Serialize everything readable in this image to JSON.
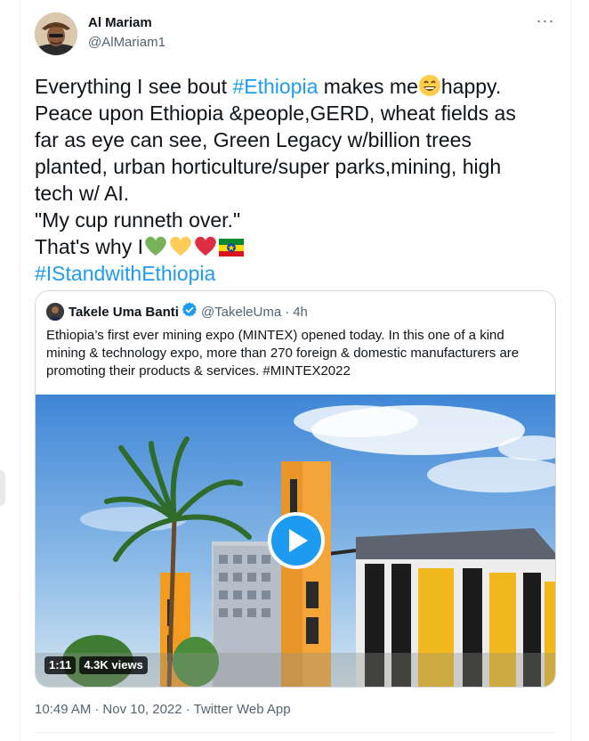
{
  "author": {
    "display_name": "Al Mariam",
    "handle": "@AlMariam1",
    "avatar_icon": "user-avatar"
  },
  "more_icon": "more-horizontal-icon",
  "tweet": {
    "line1_pre": "Everything I see bout ",
    "line1_hashtag": "#Ethiopia",
    "line1_mid": " makes me",
    "line1_emoji": "grinning-face-emoji",
    "line1_post": "happy.",
    "line2": "Peace upon Ethiopia &people,GERD, wheat fields as",
    "line3": "far as eye can see, Green Legacy w/billion trees",
    "line4": "planted, urban horticulture/super parks,mining, high",
    "line5": "tech w/ AI.",
    "line6": "\"My cup runneth over.\"",
    "line7": "That's why I",
    "line7_emojis": [
      "green-heart-emoji",
      "yellow-heart-emoji",
      "red-heart-emoji",
      "ethiopia-flag-emoji"
    ],
    "line8_hashtag": " #IStandwithEthiopia"
  },
  "quoted": {
    "display_name": "Takele Uma Banti",
    "verified_icon": "verified-badge-icon",
    "handle": "@TakeleUma",
    "dot": "·",
    "time": "4h",
    "text_line1": "Ethiopia’s first ever mining expo (MINTEX) opened today. In this one of a kind",
    "text_line2": "mining & technology expo, more than 270 foreign & domestic manufacturers are",
    "text_line3": "promoting their products & services. #MINTEX2022",
    "video": {
      "duration": "1:11",
      "views": "4.3K views",
      "play_icon": "play-icon"
    }
  },
  "meta": {
    "time": "10:49 AM",
    "sep1": "·",
    "date": "Nov 10, 2022",
    "sep2": "·",
    "source": "Twitter Web App"
  },
  "colors": {
    "link": "#1d9bf0",
    "text": "#0f1419",
    "secondary": "#536471",
    "border": "#cfd9de"
  }
}
